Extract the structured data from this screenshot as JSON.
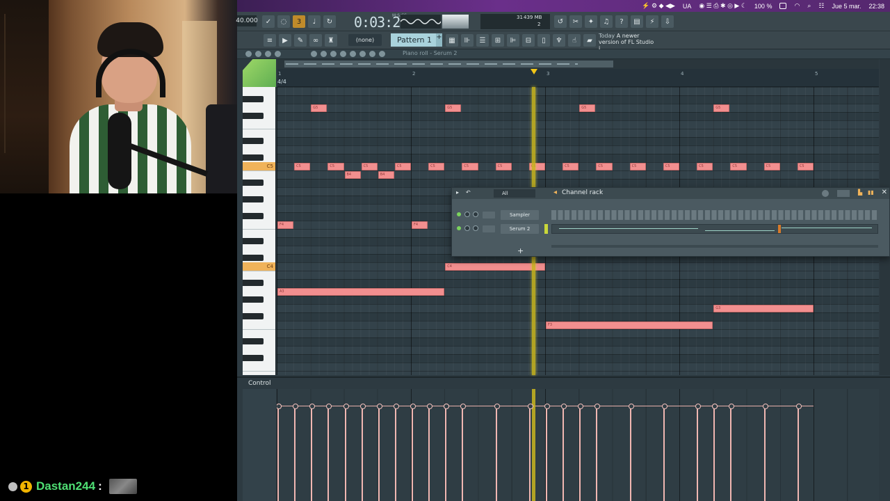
{
  "menubar": {
    "items": [
      "UA",
      "100 %",
      "Jue 5 mar.",
      "22:38"
    ]
  },
  "toolbar": {
    "tempo": "40.000",
    "time": "0:03:29",
    "time_unit": "M:S:CS",
    "cpu_value": "31",
    "memory": "439 MB",
    "voices": "2",
    "pattern_picker": "(none)",
    "pattern": "Pattern 1",
    "pattern_add": "+",
    "news_line1": "Today",
    "news_line2": "A newer version of FL Studio i..."
  },
  "piano_roll": {
    "breadcrumb": "Piano roll - Serum 2",
    "time_signature": "4/4",
    "bars": [
      "1",
      "2",
      "3",
      "4",
      "5"
    ],
    "key_labels": [
      "C5",
      "C4"
    ],
    "notes": [
      {
        "label": "G5",
        "bar": 1.25,
        "len": 0.125,
        "row": "G5"
      },
      {
        "label": "G5",
        "bar": 2.25,
        "len": 0.125,
        "row": "G5"
      },
      {
        "label": "G5",
        "bar": 3.25,
        "len": 0.125,
        "row": "G5"
      },
      {
        "label": "G5",
        "bar": 4.25,
        "len": 0.125,
        "row": "G5"
      },
      {
        "label": "C5",
        "bar": 1.125,
        "len": 0.125,
        "row": "C5"
      },
      {
        "label": "C5",
        "bar": 1.375,
        "len": 0.125,
        "row": "C5"
      },
      {
        "label": "C5",
        "bar": 1.625,
        "len": 0.125,
        "row": "C5"
      },
      {
        "label": "C5",
        "bar": 1.875,
        "len": 0.125,
        "row": "C5"
      },
      {
        "label": "C5",
        "bar": 2.125,
        "len": 0.125,
        "row": "C5"
      },
      {
        "label": "C5",
        "bar": 2.375,
        "len": 0.125,
        "row": "C5"
      },
      {
        "label": "C5",
        "bar": 2.625,
        "len": 0.125,
        "row": "C5"
      },
      {
        "label": "C5",
        "bar": 2.875,
        "len": 0.125,
        "row": "C5"
      },
      {
        "label": "C5",
        "bar": 3.125,
        "len": 0.125,
        "row": "C5"
      },
      {
        "label": "C5",
        "bar": 3.375,
        "len": 0.125,
        "row": "C5"
      },
      {
        "label": "C5",
        "bar": 3.625,
        "len": 0.125,
        "row": "C5"
      },
      {
        "label": "C5",
        "bar": 3.875,
        "len": 0.125,
        "row": "C5"
      },
      {
        "label": "C5",
        "bar": 4.125,
        "len": 0.125,
        "row": "C5"
      },
      {
        "label": "C5",
        "bar": 4.375,
        "len": 0.125,
        "row": "C5"
      },
      {
        "label": "C5",
        "bar": 4.625,
        "len": 0.125,
        "row": "C5"
      },
      {
        "label": "C5",
        "bar": 4.875,
        "len": 0.125,
        "row": "C5"
      },
      {
        "label": "B4",
        "bar": 1.5,
        "len": 0.125,
        "row": "B4"
      },
      {
        "label": "B4",
        "bar": 1.75,
        "len": 0.125,
        "row": "B4"
      },
      {
        "label": "F4",
        "bar": 1.0,
        "len": 0.125,
        "row": "F4"
      },
      {
        "label": "F4",
        "bar": 2.0,
        "len": 0.125,
        "row": "F4"
      },
      {
        "label": "C4",
        "bar": 2.25,
        "len": 0.75,
        "row": "C4"
      },
      {
        "label": "A3",
        "bar": 1.0,
        "len": 1.25,
        "row": "A3"
      },
      {
        "label": "G3",
        "bar": 4.25,
        "len": 0.75,
        "row": "G3"
      },
      {
        "label": "F3",
        "bar": 3.0,
        "len": 1.25,
        "row": "F3"
      }
    ]
  },
  "channel_rack": {
    "title": "Channel rack",
    "filter": "All",
    "channels": [
      "Sampler",
      "Serum 2"
    ],
    "add_label": "+"
  },
  "control": {
    "label": "Control"
  },
  "chat": {
    "badge": "1",
    "username": "Dastan244",
    "separator": ":"
  },
  "colors": {
    "note": "#f28f8f",
    "playhead": "#c9b61e",
    "grid": "#33424a",
    "chat_user": "#4fdf74",
    "key_highlight": "#f0b35a"
  }
}
